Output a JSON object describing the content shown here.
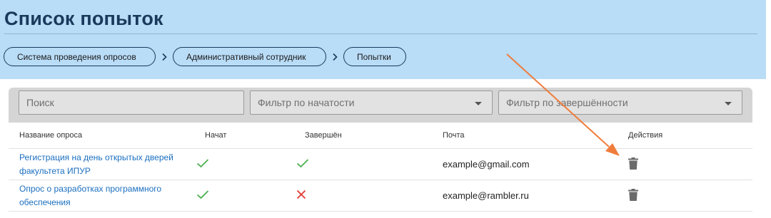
{
  "header": {
    "title": "Список попыток",
    "breadcrumbs": [
      {
        "label": "Система проведения опросов"
      },
      {
        "label": "Административный сотрудник"
      },
      {
        "label": "Попытки"
      }
    ]
  },
  "filters": {
    "search_placeholder": "Поиск",
    "started_filter_label": "Фильтр по начатости",
    "finished_filter_label": "Фильтр по завершённости"
  },
  "table": {
    "columns": [
      "Название опроса",
      "Начат",
      "Завершён",
      "Почта",
      "Действия"
    ],
    "rows": [
      {
        "survey_line1": "Регистрация на день открытых дверей",
        "survey_line2": "факультета ИПУР",
        "started": true,
        "finished": true,
        "email": "example@gmail.com",
        "action_icon": "trash-icon"
      },
      {
        "survey_line1": "Опрос о разработках программного",
        "survey_line2": "обеспечения",
        "started": true,
        "finished": false,
        "email": "example@rambler.ru",
        "action_icon": "trash-icon"
      }
    ]
  },
  "colors": {
    "header_bg": "#b9dcf7",
    "title": "#1a3a5c",
    "link": "#1b6fc0",
    "check": "#4caf50",
    "cross": "#e53935",
    "annotation_arrow": "#f07c3c"
  }
}
